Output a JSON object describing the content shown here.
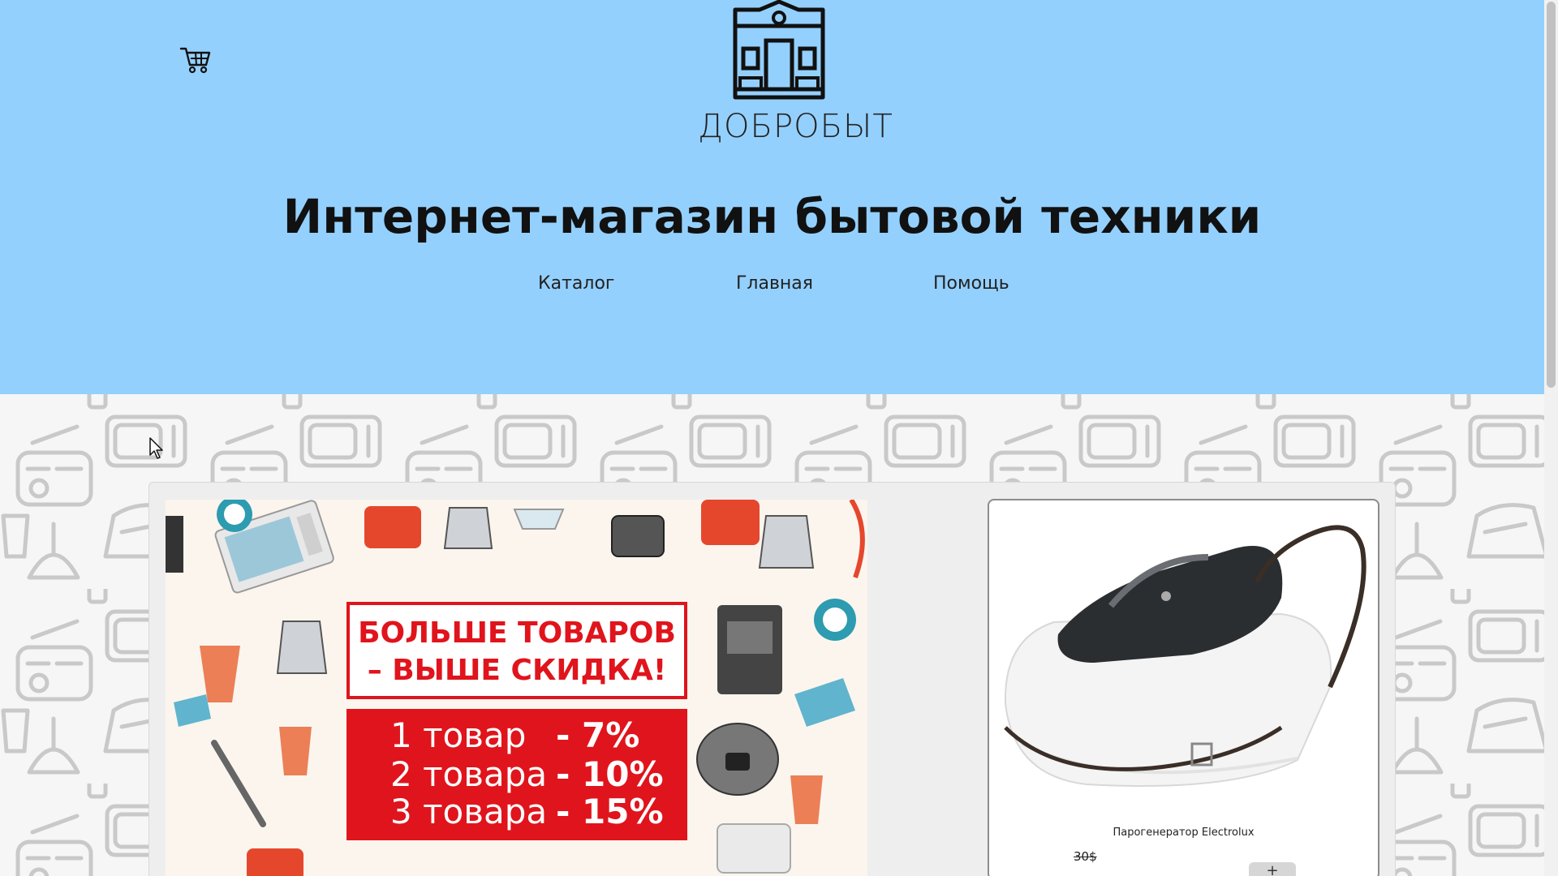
{
  "header": {
    "logo_text": "ДОБРОБЫТ",
    "title": "Интернет-магазин бытовой техники",
    "nav": [
      {
        "label": "Каталог"
      },
      {
        "label": "Главная"
      },
      {
        "label": "Помощь"
      }
    ]
  },
  "promo": {
    "headline_1": "БОЛЬШЕ ТОВАРОВ",
    "headline_2": "– ВЫШЕ СКИДКА!",
    "tiers": [
      {
        "label": "1 товар",
        "discount": "- 7%"
      },
      {
        "label": "2 товара",
        "discount": "- 10%"
      },
      {
        "label": "3 товара",
        "discount": "- 15%"
      }
    ]
  },
  "product": {
    "name": "Парогенератор Electrolux",
    "old_price": "30$",
    "add_label": "+",
    "brand": "Electrolux"
  },
  "colors": {
    "header_bg": "#94d0fd",
    "promo_red": "#e0141c"
  },
  "icons": {
    "cart": "cart-icon",
    "logo": "house-logo-icon"
  }
}
